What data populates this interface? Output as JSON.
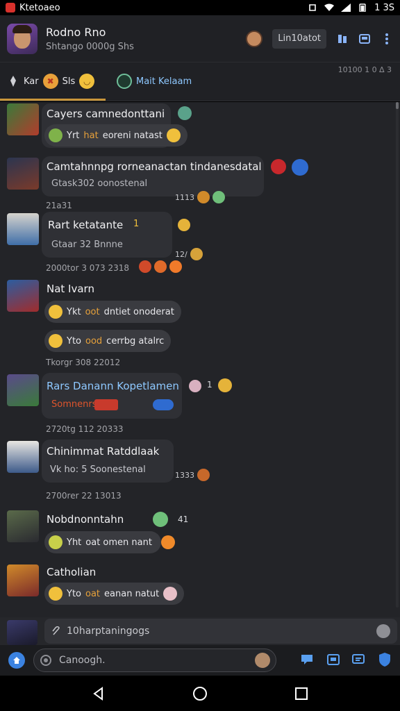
{
  "status_bar": {
    "left_text": "Ktetoaeo",
    "time": "1 3S"
  },
  "header": {
    "title": "Rodno Rno",
    "subtitle": "Shtango 0000g Shs",
    "button_label": "Lin10atot"
  },
  "tabs": [
    {
      "label": "Kar",
      "extra": "Sls"
    },
    {
      "label": "Mait Kelaam"
    }
  ],
  "tab_count": "10100 1 0 ∆ 3",
  "messages": [
    {
      "name": "Cayers camnedonttani",
      "text_prefix": "Yrt",
      "text_accent": "hat",
      "text_rest": "eoreni natast"
    },
    {
      "name": "Camtahnnpg rorneanactan tindanesdatal",
      "text": "Gtask302 oonostenal",
      "timestamp": "21a31",
      "reaction_count": "1113"
    },
    {
      "name": "Rart ketatante",
      "name_badge": "1",
      "text": "Gtaar 32 Bnnne",
      "timestamp": "2000tor 3 073 2318",
      "reaction_count": "12/"
    },
    {
      "name": "Nat Ivarn",
      "line1_prefix": "Ykt",
      "line1_accent": "oot",
      "line1_rest": "dntiet onoderat",
      "line2_prefix": "Yto",
      "line2_accent": "ood",
      "line2_rest": "cerrbg atalrc",
      "timestamp": "Tkorgr 308 22012"
    },
    {
      "name": "Rars Danann Kopetlamen",
      "text_accent": "Somnenrs",
      "react_count": "1",
      "timestamp": "2720tg 112 20333"
    },
    {
      "name": "Chinimmat Ratddlaak",
      "text": "Vk ho: 5 Soonestenal",
      "timestamp": "2700rer 22 13013",
      "reaction_count": "1333"
    },
    {
      "name": "Nobdnonntahn",
      "text_prefix": "Yht",
      "text_rest": "oat omen nant",
      "react_count": "41"
    },
    {
      "name": "Catholian",
      "text_prefix": "Yto",
      "text_accent": "oat",
      "text_rest": "eanan natut"
    }
  ],
  "input": {
    "value": "10harptaningogs"
  },
  "bottom_search": {
    "placeholder": "Canoogh."
  },
  "colors": {
    "accent": "#e7a13a",
    "background": "#232428",
    "bubble": "#2f3035",
    "link": "#8ec8ff",
    "tab_indicator": "#c9963b"
  },
  "icons": [
    "back-icon",
    "home-icon",
    "recents-icon",
    "search-icon",
    "shield-icon",
    "chat-icon",
    "more-icon"
  ]
}
